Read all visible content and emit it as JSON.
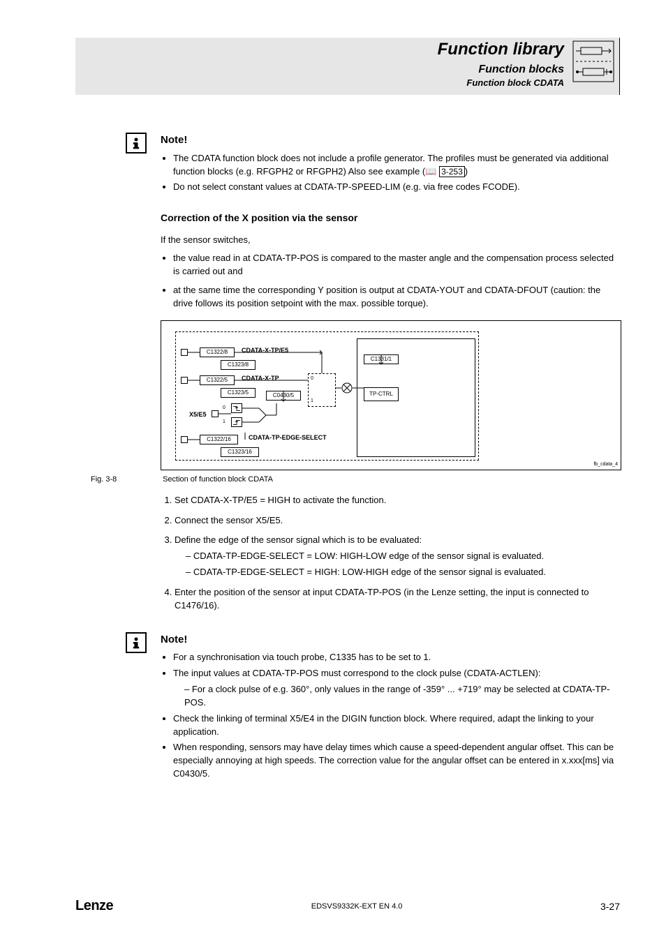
{
  "header": {
    "title": "Function library",
    "sub1": "Function blocks",
    "sub2": "Function block CDATA"
  },
  "note1": {
    "heading": "Note!",
    "items": [
      "The CDATA function block does not include a profile generator. The profiles must be generated via additional function blocks (e.g. RFGPH2 or RFGPH2) Also see example",
      "Do not select constant values at CDATA-TP-SPEED-LIM (e.g. via free codes FCODE)."
    ],
    "ref_icon": "📖",
    "ref": "3-253"
  },
  "section_heading": "Correction of the X position via the sensor",
  "intro": "If the sensor switches,",
  "bullets": [
    "the value read in at CDATA-TP-POS is compared to the master angle and the compensation process selected is carried out and",
    "at the same time the corresponding Y position is output at CDATA-YOUT and CDATA-DFOUT (caution: the drive follows its position setpoint with the max. possible torque)."
  ],
  "diagram": {
    "labels": {
      "l1": "CDATA-X-TP/E5",
      "l2": "CDATA-X-TP",
      "l3": "CDATA-TP-EDGE-SELECT",
      "x5": "X5/E5",
      "tpctrl": "TP-CTRL"
    },
    "boxes": {
      "b1": "C1322/8",
      "b2": "C1323/8",
      "b3": "C1322/5",
      "b4": "C1323/5",
      "b5": "C0430/5",
      "b6": "C1331/1",
      "b7": "C1322/16",
      "b8": "C1323/16"
    },
    "ref": "fb_cdata_4"
  },
  "fig": {
    "num": "Fig. 3-8",
    "caption": "Section of function block CDATA"
  },
  "steps": {
    "s1": "Set CDATA-X-TP/E5 = HIGH to activate the function.",
    "s2": "Connect the sensor X5/E5.",
    "s3": "Define the edge of the sensor signal which is to be evaluated:",
    "s3a": "– CDATA-TP-EDGE-SELECT = LOW: HIGH-LOW edge of the sensor signal is evaluated.",
    "s3b": "– CDATA-TP-EDGE-SELECT = HIGH: LOW-HIGH edge of the sensor signal is evaluated.",
    "s4": "Enter the position of the sensor at input CDATA-TP-POS (in the Lenze setting, the input is connected to C1476/16)."
  },
  "note2": {
    "heading": "Note!",
    "li1": "For a synchronisation via touch probe, C1335 has to be set to 1.",
    "li2": "The input values at CDATA-TP-POS must correspond to the clock pulse (CDATA-ACTLEN):",
    "li2a": "– For a clock pulse of e.g. 360°, only values in the range of -359° ... +719° may be selected at CDATA-TP-POS.",
    "li3": "Check the linking of terminal X5/E4 in the DIGIN function block. Where required, adapt the linking to your application.",
    "li4": "When responding, sensors may have delay times which cause a speed-dependent angular offset. This can be especially annoying at high speeds. The correction value for the angular offset can be entered in x.xxx[ms] via C0430/5."
  },
  "footer": {
    "logo": "Lenze",
    "center": "EDSVS9332K-EXT EN 4.0",
    "page": "3-27"
  }
}
